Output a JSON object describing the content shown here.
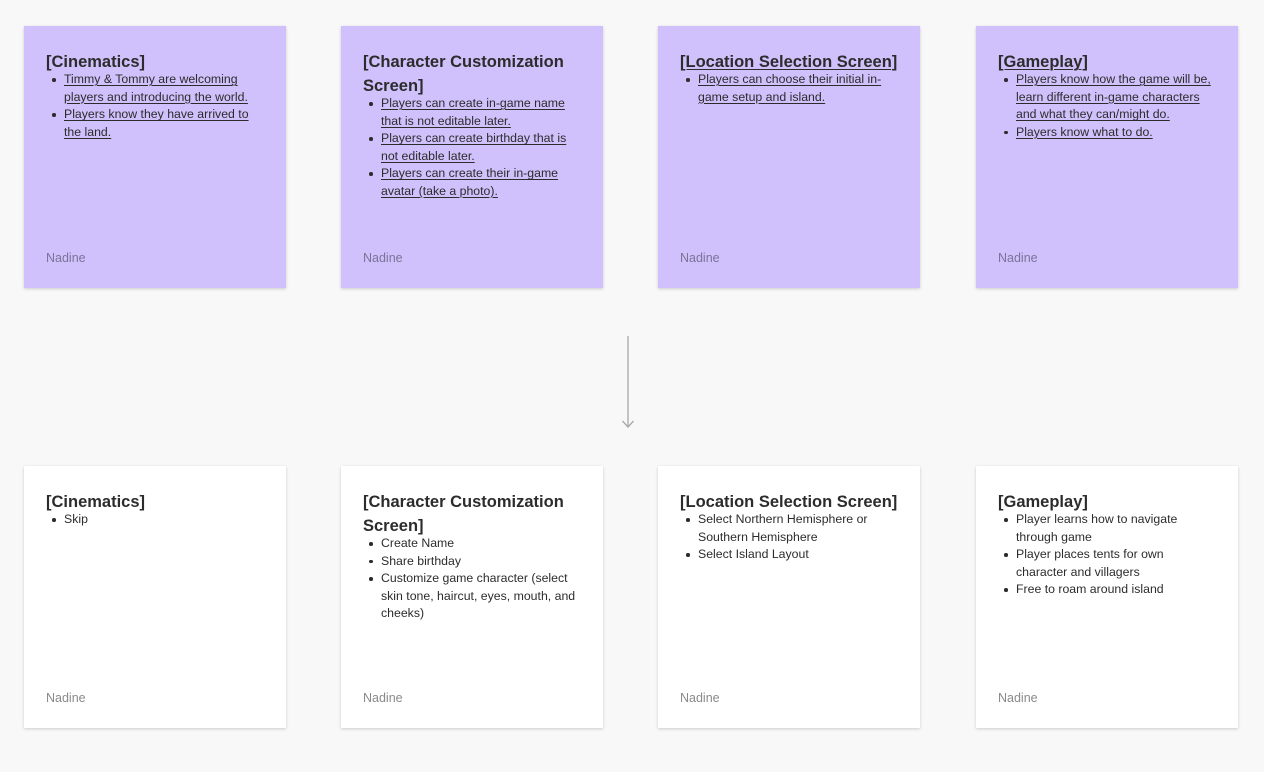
{
  "top_row": [
    {
      "title": "[Cinematics]",
      "items": [
        "Timmy & Tommy are welcoming players and introducing the world.",
        "Players know they have arrived to the land."
      ],
      "author": "Nadine"
    },
    {
      "title": "[Character Customization Screen]",
      "items": [
        "Players can create in-game name that is not editable later.",
        "Players can create birthday that is not editable later.",
        "Players can create their in-game avatar (take a photo)."
      ],
      "author": "Nadine"
    },
    {
      "title": "[Location Selection Screen]",
      "items": [
        "Players can choose their initial in-game setup and island."
      ],
      "author": "Nadine"
    },
    {
      "title": "[Gameplay]",
      "items": [
        "Players know how the game will be, learn different in-game characters and what they can/might do.",
        "Players know what to do."
      ],
      "author": "Nadine"
    }
  ],
  "bottom_row": [
    {
      "title": "[Cinematics]",
      "items": [
        "Skip"
      ],
      "author": "Nadine"
    },
    {
      "title": "[Character Customization Screen]",
      "items": [
        "Create Name",
        "Share birthday",
        "Customize game character (select skin tone, haircut, eyes, mouth, and cheeks)"
      ],
      "author": "Nadine"
    },
    {
      "title": "[Location Selection Screen]",
      "items": [
        "Select Northern Hemisphere or Southern Hemisphere",
        "Select Island Layout"
      ],
      "author": "Nadine"
    },
    {
      "title": "[Gameplay]",
      "items": [
        "Player learns how to navigate through game",
        "Player places tents for own character and villagers",
        "Free to roam around island"
      ],
      "author": "Nadine"
    }
  ],
  "colors": {
    "canvas_background": "#f8f8f8",
    "sticky_purple": "#d0c0fb",
    "sticky_white": "#ffffff",
    "connector": "#a9a9a9"
  }
}
